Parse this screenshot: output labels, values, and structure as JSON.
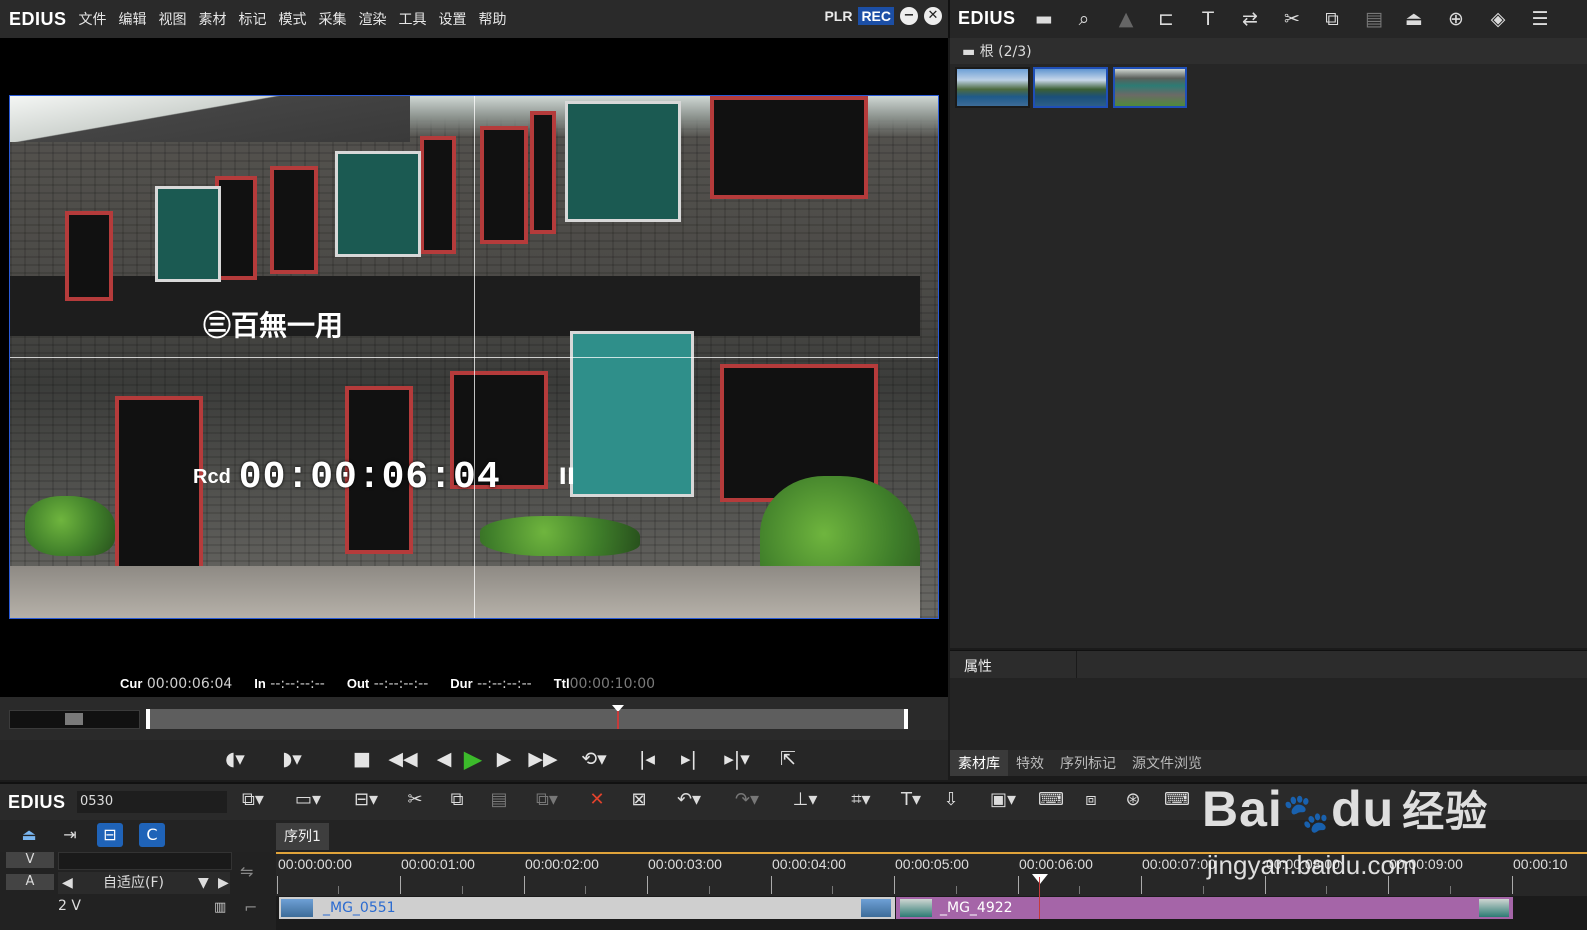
{
  "app": {
    "logo": "EDIUS",
    "menu": [
      "文件",
      "编辑",
      "视图",
      "素材",
      "标记",
      "模式",
      "采集",
      "渲染",
      "工具",
      "设置",
      "帮助"
    ],
    "mode_plr": "PLR",
    "mode_rec": "REC"
  },
  "player": {
    "sign_text": "㊂百無一用",
    "overlay_label": "Rcd",
    "overlay_timecode": "00:00:06:04",
    "overlay_state": "II",
    "cur_label": "Cur",
    "cur_value": "00:00:06:04",
    "in_label": "In",
    "in_value": "--:--:--:--",
    "out_label": "Out",
    "out_value": "--:--:--:--",
    "dur_label": "Dur",
    "dur_value": "--:--:--:--",
    "ttl_label": "Ttl",
    "ttl_value": "00:00:10:00",
    "playhead_fraction": 0.613
  },
  "bin": {
    "logo": "EDIUS",
    "folder": "根 (2/3)",
    "properties_label": "属性",
    "tabs": [
      "素材库",
      "特效",
      "序列标记",
      "源文件浏览"
    ],
    "active_tab": "素材库"
  },
  "timeline": {
    "logo": "EDIUS",
    "project_name": "0530",
    "sequence_tab": "序列1",
    "ruler_labels": [
      "00:00:00:00",
      "00:00:01:00",
      "00:00:02:00",
      "00:00:03:00",
      "00:00:04:00",
      "00:00:05:00",
      "00:00:06:00",
      "00:00:07:00",
      "00:00:08:00",
      "00:00:09:00",
      "00:00:10"
    ],
    "track_v": "V",
    "track_a": "A",
    "audio_mode": "自适应(F)",
    "track_2v": "2 V",
    "clip1_name": "_MG_0551",
    "clip2_name": "_MG_4922"
  },
  "watermark": {
    "brand": "Bai",
    "du": "du",
    "cn": "经验",
    "url": "jingyan.baidu.com"
  },
  "colors": {
    "accent_blue": "#1f4fb8",
    "rec_blue": "#1c4fa6",
    "clip1": "#c8c8c8",
    "clip2": "#a565a8",
    "ruler_bar": "#e0a33a",
    "delete_red": "#e0422c"
  }
}
